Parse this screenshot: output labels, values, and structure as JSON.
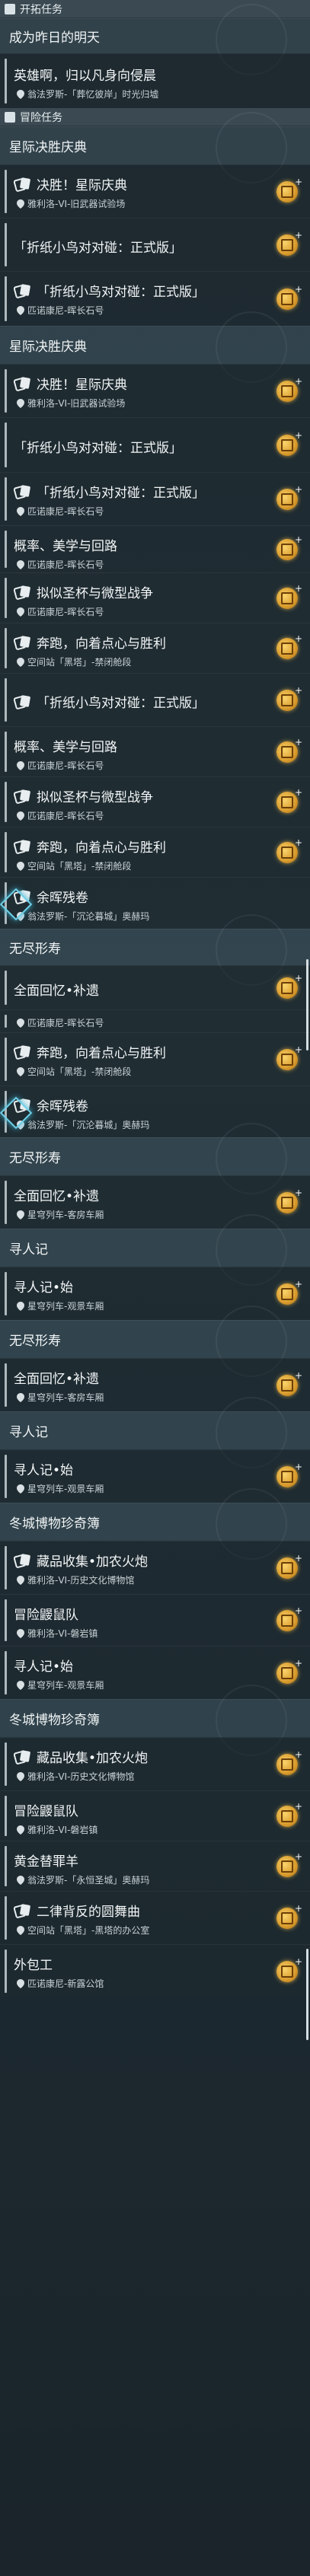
{
  "sections": {
    "side_quests": "开拓任务",
    "adventure": "冒险任务"
  },
  "groups": [
    {
      "id": "g0",
      "label": "成为昨日的明天"
    },
    {
      "id": "g1",
      "label": "星际决胜庆典"
    },
    {
      "id": "g2",
      "label": "星际决胜庆典"
    },
    {
      "id": "g3",
      "label": "无尽形寿"
    },
    {
      "id": "g4",
      "label": "无尽形寿"
    },
    {
      "id": "g5",
      "label": "寻人记"
    },
    {
      "id": "g6",
      "label": "无尽形寿"
    },
    {
      "id": "g7",
      "label": "寻人记"
    },
    {
      "id": "g8",
      "label": "冬城博物珍奇簿"
    },
    {
      "id": "g9",
      "label": "冬城博物珍奇簿"
    }
  ],
  "quests": [
    {
      "title": "英雄啊，归以凡身向侵晨",
      "loc": "翁法罗斯-「葬忆彼岸」时光归墟",
      "cards": false,
      "badge": false
    },
    {
      "title": "决胜！星际庆典",
      "loc": "雅利洛-VI-旧武器试验场",
      "cards": true,
      "badge": true
    },
    {
      "title": "「折纸小鸟对对碰：正式版」",
      "loc": "",
      "cards": false,
      "badge": true
    },
    {
      "title": "「折纸小鸟对对碰：正式版」",
      "loc": "匹诺康尼-晖长石号",
      "cards": true,
      "badge": true
    },
    {
      "title": "决胜！星际庆典",
      "loc": "雅利洛-VI-旧武器试验场",
      "cards": true,
      "badge": true
    },
    {
      "title": "「折纸小鸟对对碰：正式版」",
      "loc": "",
      "cards": false,
      "badge": true
    },
    {
      "title": "「折纸小鸟对对碰：正式版」",
      "loc": "匹诺康尼-晖长石号",
      "cards": true,
      "badge": true
    },
    {
      "title": "概率、美学与回路",
      "loc": "匹诺康尼-晖长石号",
      "cards": false,
      "badge": true
    },
    {
      "title": "拟似圣杯与微型战争",
      "loc": "匹诺康尼-晖长石号",
      "cards": true,
      "badge": true
    },
    {
      "title": "奔跑，向着点心与胜利",
      "loc": "空间站「黑塔」-禁闭舱段",
      "cards": true,
      "badge": true
    },
    {
      "title": "「折纸小鸟对对碰：正式版」",
      "loc": "",
      "cards": true,
      "badge": true
    },
    {
      "title": "概率、美学与回路",
      "loc": "匹诺康尼-晖长石号",
      "cards": false,
      "badge": true
    },
    {
      "title": "拟似圣杯与微型战争",
      "loc": "匹诺康尼-晖长石号",
      "cards": true,
      "badge": true
    },
    {
      "title": "奔跑，向着点心与胜利",
      "loc": "空间站「黑塔」-禁闭舱段",
      "cards": true,
      "badge": true
    },
    {
      "title": "余晖残卷",
      "loc": "翁法罗斯-「沉沦暮城」奥赫玛",
      "cards": true,
      "badge": false
    },
    {
      "title": "全面回忆•补遗",
      "loc": "",
      "cards": false,
      "badge": true
    },
    {
      "title": "",
      "loc": "匹诺康尼-晖长石号",
      "cards": false,
      "badge": false
    },
    {
      "title": "奔跑，向着点心与胜利",
      "loc": "空间站「黑塔」-禁闭舱段",
      "cards": true,
      "badge": true
    },
    {
      "title": "余晖残卷",
      "loc": "翁法罗斯-「沉沦暮城」奥赫玛",
      "cards": true,
      "badge": false
    },
    {
      "title": "全面回忆•补遗",
      "loc": "星穹列车-客房车厢",
      "cards": false,
      "badge": true
    },
    {
      "title": "寻人记•始",
      "loc": "星穹列车-观景车厢",
      "cards": false,
      "badge": true
    },
    {
      "title": "全面回忆•补遗",
      "loc": "星穹列车-客房车厢",
      "cards": false,
      "badge": true
    },
    {
      "title": "寻人记•始",
      "loc": "星穹列车-观景车厢",
      "cards": false,
      "badge": true
    },
    {
      "title": "藏品收集•加农火炮",
      "loc": "雅利洛-VI-历史文化博物馆",
      "cards": true,
      "badge": true
    },
    {
      "title": "冒险鼹鼠队",
      "loc": "雅利洛-VI-磐岩镇",
      "cards": false,
      "badge": true
    },
    {
      "title": "寻人记•始",
      "loc": "星穹列车-观景车厢",
      "cards": false,
      "badge": true
    },
    {
      "title": "藏品收集•加农火炮",
      "loc": "雅利洛-VI-历史文化博物馆",
      "cards": true,
      "badge": true
    },
    {
      "title": "冒险鼹鼠队",
      "loc": "雅利洛-VI-磐岩镇",
      "cards": false,
      "badge": true
    },
    {
      "title": "黄金替罪羊",
      "loc": "翁法罗斯-「永恒圣城」奥赫玛",
      "cards": false,
      "badge": true
    },
    {
      "title": "二律背反的圆舞曲",
      "loc": "空间站「黑塔」-黑塔的办公室",
      "cards": true,
      "badge": true
    },
    {
      "title": "外包工",
      "loc": "匹诺康尼-新露公馆",
      "cards": false,
      "badge": true
    }
  ]
}
